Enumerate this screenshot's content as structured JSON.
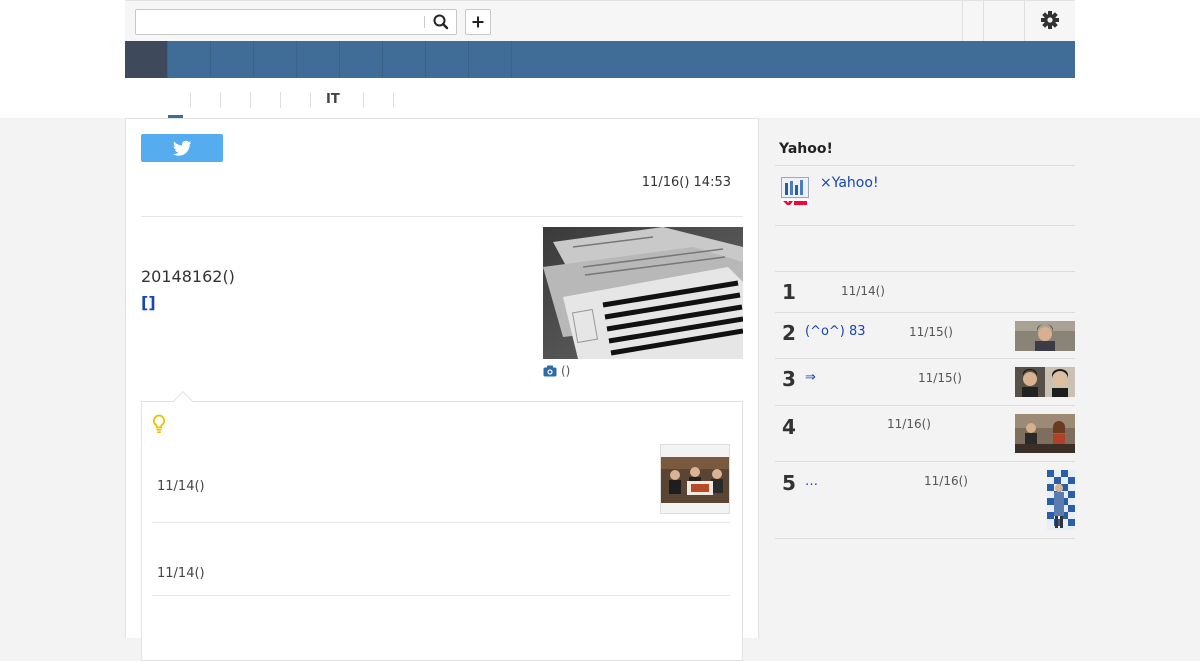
{
  "toolbar": {
    "search_placeholder": "",
    "search_value": "",
    "add_label": "+"
  },
  "nav": {
    "items": [
      "",
      "",
      "",
      "",
      "",
      "",
      "",
      "",
      ""
    ],
    "active_index": 0
  },
  "categories": {
    "tabs": [
      "",
      "",
      "",
      "",
      "",
      "IT",
      "",
      ""
    ],
    "active_index": 0
  },
  "article": {
    "date": "11/16() 14:53",
    "body": "20148162()",
    "source_link": "[]",
    "photo_caption": "()"
  },
  "related": {
    "items": [
      {
        "date": "11/14()",
        "has_thumb": true
      },
      {
        "date": "11/14()",
        "has_thumb": false
      }
    ]
  },
  "sidebar": {
    "title": "Yahoo!",
    "promo_link": "×Yahoo!",
    "ranking": [
      {
        "rank": "1",
        "text": "",
        "date": "11/14()"
      },
      {
        "rank": "2",
        "text": "(^o^) 83",
        "date": "11/15()"
      },
      {
        "rank": "3",
        "text": "⇒",
        "date": "11/15()"
      },
      {
        "rank": "4",
        "text": "",
        "date": "11/16()"
      },
      {
        "rank": "5",
        "text": "…",
        "date": "11/16()"
      }
    ]
  },
  "colors": {
    "nav_bar": "#3f6d98",
    "nav_active": "#3e4a5c",
    "link": "#1646b4",
    "twitter": "#55acee",
    "bulb": "#e8c200"
  },
  "icons": {
    "search": "search-icon",
    "add": "plus-icon",
    "settings": "gear-icon",
    "tweet": "twitter-bird-icon",
    "camera": "camera-icon",
    "related": "lightbulb-icon"
  }
}
